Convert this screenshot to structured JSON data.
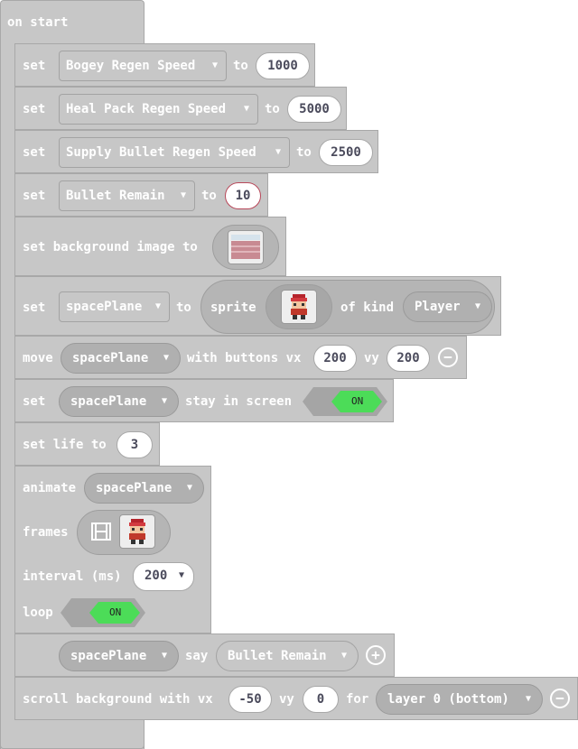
{
  "colors": {
    "block_bg": "#c7c7c7",
    "toggle_on": "#4cdc58",
    "value_text": "#4b4b5c"
  },
  "event": {
    "label": "on start"
  },
  "set_bogey": {
    "set": "set",
    "var": "Bogey Regen Speed",
    "to": "to",
    "value": "1000"
  },
  "set_heal": {
    "set": "set",
    "var": "Heal Pack Regen Speed",
    "to": "to",
    "value": "5000"
  },
  "set_supply": {
    "set": "set",
    "var": "Supply Bullet Regen Speed",
    "to": "to",
    "value": "2500"
  },
  "set_bullet": {
    "set": "set",
    "var": "Bullet Remain",
    "to": "to",
    "value": "10"
  },
  "set_bg": {
    "label": "set background image to",
    "image": "background-image"
  },
  "set_plane": {
    "set": "set",
    "var": "spacePlane",
    "to": "to",
    "sprite": "sprite",
    "of_kind": "of kind",
    "kind": "Player",
    "image": "player-sprite"
  },
  "move": {
    "move": "move",
    "var": "spacePlane",
    "with": "with buttons vx",
    "vx": "200",
    "vy_label": "vy",
    "vy": "200"
  },
  "stay": {
    "set": "set",
    "var": "spacePlane",
    "label": "stay in screen",
    "toggle": "ON"
  },
  "life": {
    "label": "set life to",
    "value": "3"
  },
  "animate": {
    "label": "animate",
    "var": "spacePlane",
    "frames": "frames",
    "interval_label": "interval (ms)",
    "interval": "200",
    "loop": "loop",
    "toggle": "ON"
  },
  "say": {
    "var": "spacePlane",
    "say": "say",
    "value": "Bullet Remain"
  },
  "scroll": {
    "label": "scroll background with vx",
    "vx": "-50",
    "vy_label": "vy",
    "vy": "0",
    "for": "for",
    "layer": "layer 0 (bottom)"
  }
}
